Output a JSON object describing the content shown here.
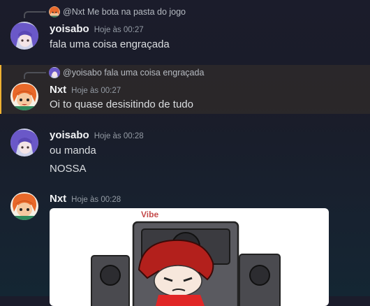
{
  "messages": [
    {
      "reply": {
        "author": "@Nxt",
        "text": "Me bota na pasta do jogo"
      },
      "author": "yoisabo",
      "timestamp": "Hoje às 00:27",
      "lines": [
        "fala uma coisa engraçada"
      ]
    },
    {
      "reply": {
        "author": "@yoisabo",
        "text": "fala uma coisa engraçada"
      },
      "author": "Nxt",
      "timestamp": "Hoje às 00:27",
      "lines": [
        "Oi to quase desisitindo de tudo"
      ],
      "mentioned": true
    },
    {
      "author": "yoisabo",
      "timestamp": "Hoje às 00:28",
      "lines": [
        "ou manda",
        "NOSSA"
      ]
    },
    {
      "author": "Nxt",
      "timestamp": "Hoje às 00:28",
      "attachment": {
        "type": "image",
        "title": "Vibe"
      }
    }
  ],
  "colors": {
    "username": "#f2f3f5",
    "text": "#dbdee1",
    "timestamp": "#949ba4",
    "mention_highlight": "#f0b232"
  },
  "icons": {
    "yoisabo_avatar": "purple-hair-anime-avatar",
    "nxt_avatar": "orange-hair-cartoon-avatar"
  }
}
